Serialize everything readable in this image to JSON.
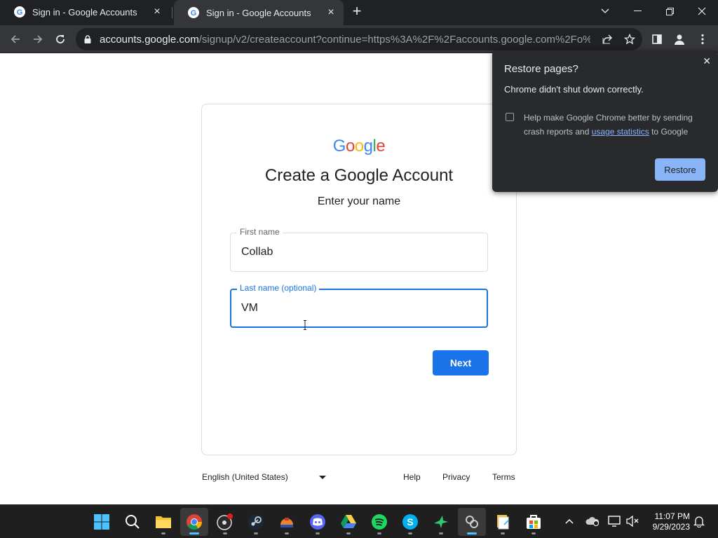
{
  "tabs": [
    {
      "title": "Sign in - Google Accounts",
      "active": false
    },
    {
      "title": "Sign in - Google Accounts",
      "active": true
    }
  ],
  "address_bar": {
    "host": "accounts.google.com",
    "path": "/signup/v2/createaccount?continue=https%3A%2F%2Faccounts.google.com%2Fo%2Foaut..."
  },
  "page": {
    "logo_text": "Google",
    "logo_colors": [
      "#4285F4",
      "#EA4335",
      "#FBBC05",
      "#4285F4",
      "#34A853",
      "#EA4335"
    ],
    "title": "Create a Google Account",
    "subtitle": "Enter your name",
    "first_name": {
      "label": "First name",
      "value": "Collab"
    },
    "last_name": {
      "label": "Last name (optional)",
      "value": "VM"
    },
    "next_label": "Next",
    "accent_color": "#1a73e8"
  },
  "footer": {
    "language": "English (United States)",
    "links": [
      "Help",
      "Privacy",
      "Terms"
    ]
  },
  "restore_popup": {
    "title": "Restore pages?",
    "message": "Chrome didn't shut down correctly.",
    "checkbox_text_before": "Help make Google Chrome better by sending crash reports and ",
    "checkbox_link": "usage statistics",
    "checkbox_text_after": " to Google",
    "checkbox_checked": false,
    "restore_label": "Restore"
  },
  "taskbar": {
    "apps": [
      "start-icon",
      "search-icon",
      "file-explorer-icon",
      "chrome-icon",
      "obs-icon",
      "steam-icon",
      "app-icon",
      "discord-icon",
      "google-drive-icon",
      "spotify-icon",
      "skype-icon",
      "bird-app-icon",
      "link-app-icon",
      "notepad-icon",
      "store-icon"
    ],
    "time": "11:07 PM",
    "date": "9/29/2023"
  }
}
